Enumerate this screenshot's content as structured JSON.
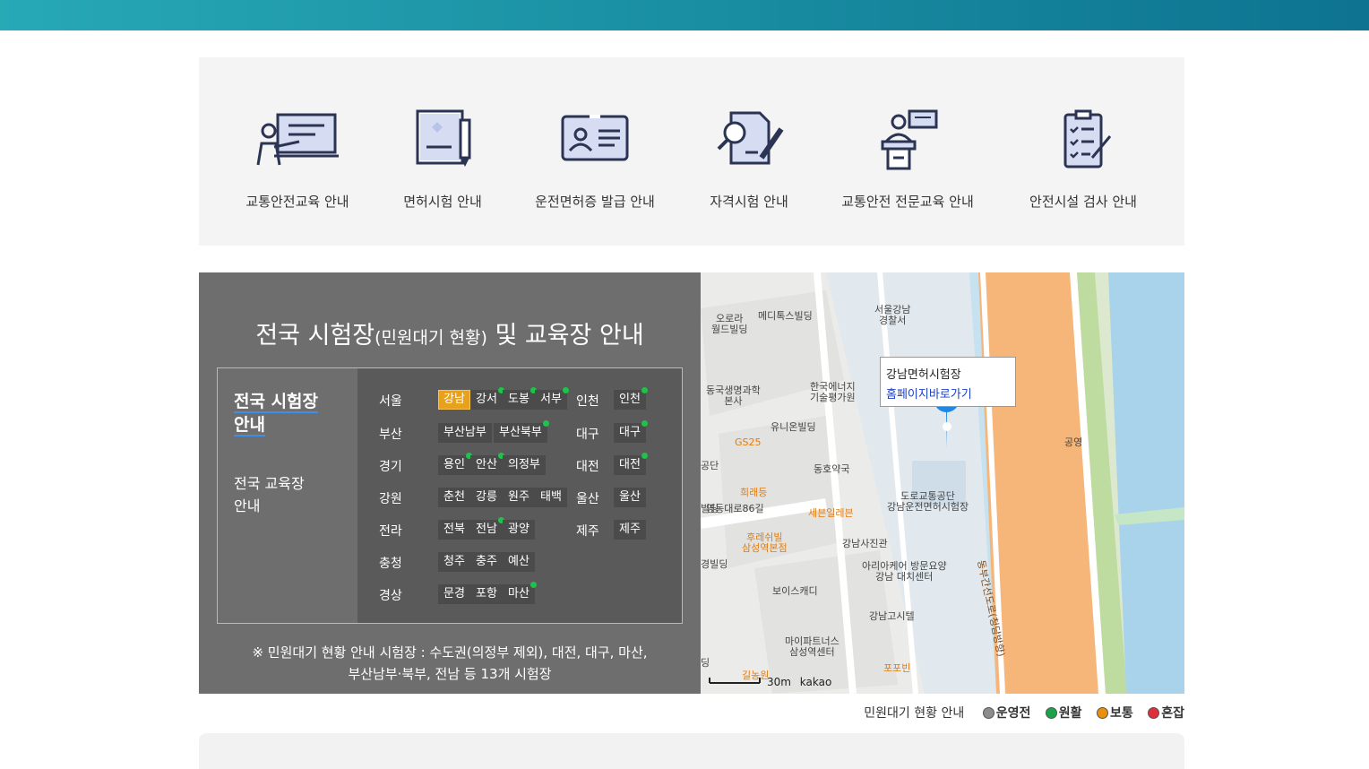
{
  "services": [
    {
      "label": "교통안전교육 안내",
      "icon": "lecture-board-icon"
    },
    {
      "label": "면허시험 안내",
      "icon": "document-pen-icon"
    },
    {
      "label": "운전면허증 발급 안내",
      "icon": "id-card-icon"
    },
    {
      "label": "자격시험 안내",
      "icon": "search-document-icon"
    },
    {
      "label": "교통안전 전문교육 안내",
      "icon": "podium-speaker-icon"
    },
    {
      "label": "안전시설 검사 안내",
      "icon": "clipboard-checklist-icon"
    }
  ],
  "panel": {
    "title_main": "전국 시험장",
    "title_small": "(민원대기 현황)",
    "title_end": " 및 교육장 안내",
    "tab_exam_line1": "전국 시험장",
    "tab_exam_line2": "안내",
    "tab_edu_line1": "전국 교육장",
    "tab_edu_line2": "안내",
    "regions_left": [
      {
        "name": "서울",
        "sites": [
          {
            "label": "강남",
            "active": true,
            "dot": false
          },
          {
            "label": "강서",
            "dot": true
          },
          {
            "label": "도봉",
            "dot": true
          },
          {
            "label": "서부",
            "dot": true
          }
        ]
      },
      {
        "name": "부산",
        "sites": [
          {
            "label": "부산남부",
            "dot": false
          },
          {
            "label": "부산북부",
            "dot": true
          }
        ]
      },
      {
        "name": "경기",
        "sites": [
          {
            "label": "용인",
            "dot": true
          },
          {
            "label": "안산",
            "dot": true
          },
          {
            "label": "의정부",
            "dot": false
          }
        ]
      },
      {
        "name": "강원",
        "sites": [
          {
            "label": "춘천",
            "dot": false
          },
          {
            "label": "강릉",
            "dot": false
          },
          {
            "label": "원주",
            "dot": false
          },
          {
            "label": "태백",
            "dot": false
          }
        ]
      },
      {
        "name": "전라",
        "sites": [
          {
            "label": "전북",
            "dot": false
          },
          {
            "label": "전남",
            "dot": true
          },
          {
            "label": "광양",
            "dot": false
          }
        ]
      },
      {
        "name": "충청",
        "sites": [
          {
            "label": "청주",
            "dot": false
          },
          {
            "label": "충주",
            "dot": false
          },
          {
            "label": "예산",
            "dot": false
          }
        ]
      },
      {
        "name": "경상",
        "sites": [
          {
            "label": "문경",
            "dot": false
          },
          {
            "label": "포항",
            "dot": false
          },
          {
            "label": "마산",
            "dot": true
          }
        ]
      }
    ],
    "regions_right": [
      {
        "name": "인천",
        "sites": [
          {
            "label": "인천",
            "dot": true
          }
        ]
      },
      {
        "name": "대구",
        "sites": [
          {
            "label": "대구",
            "dot": true
          }
        ]
      },
      {
        "name": "대전",
        "sites": [
          {
            "label": "대전",
            "dot": true
          }
        ]
      },
      {
        "name": "울산",
        "sites": [
          {
            "label": "울산",
            "dot": false
          }
        ]
      },
      {
        "name": "제주",
        "sites": [
          {
            "label": "제주",
            "dot": false
          }
        ]
      }
    ],
    "notice_line1": "※ 민원대기 현황 안내 시험장 : 수도권(의정부 제외), 대전, 대구, 마산,",
    "notice_line2": "부산남부·북부, 전남 등 13개 시험장"
  },
  "map": {
    "infobox_name": "강남면허시험장",
    "infobox_link": "홈페이지바로가기",
    "scale_label": "30m",
    "brand": "kakao",
    "labels": {
      "aurora": "오로라\n월드빌딩",
      "medix": "메디톡스빌딩",
      "police": "서울강남\n경찰서",
      "donguk": "동국생명과학\n본사",
      "energy": "한국에너지\n기술평가원",
      "gs25": "GS25",
      "union": "유니온빌딩",
      "donghwa": "동호약국",
      "huiraedeung": "희래등",
      "seven": "세븐일레븐",
      "road_agency": "도로교통공단\n강남운전면허시험장",
      "roadname": "영동대로86길",
      "hureshwi": "후레쉬빌\n삼성역본점",
      "gangnam_photo": "강남사진관",
      "ariacare": "아리아케어 방문요양\n강남 대치센터",
      "voice": "보이스캐디",
      "gogo": "강남고시텔",
      "mypartners": "마이파트너스\n삼성역센터",
      "popobin": "포포빈",
      "gilnowon": "길농원",
      "expressway": "동부간선도로(청담방향)",
      "parking": "공영",
      "gongdan": "공단",
      "bilding1": "빌딩",
      "bilding2": "경빌딩",
      "ding": "딩"
    }
  },
  "legend": {
    "title": "민원대기 현황 안내",
    "items": [
      {
        "label": "운영전",
        "color": "#8c8c8c"
      },
      {
        "label": "원활",
        "color": "#1aa34a"
      },
      {
        "label": "보통",
        "color": "#e8900c"
      },
      {
        "label": "혼잡",
        "color": "#e0303c"
      }
    ]
  }
}
